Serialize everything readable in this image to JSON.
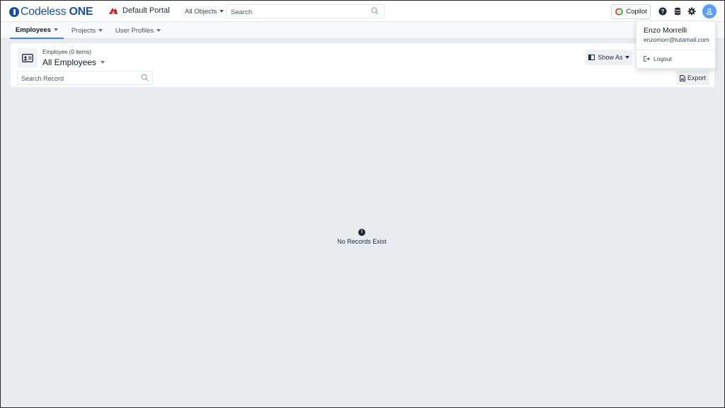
{
  "header": {
    "logo": {
      "prefix": "Codeless",
      "suffix": "ONE"
    },
    "portal_name": "Default Portal",
    "scope_select": "All Objects",
    "search_placeholder": "Search",
    "copilot_label": "Copilot",
    "icons": [
      "help-icon",
      "database-icon",
      "gear-icon",
      "user-icon"
    ]
  },
  "tabs": [
    {
      "label": "Employees",
      "active": true
    },
    {
      "label": "Projects",
      "active": false
    },
    {
      "label": "User Profiles",
      "active": false
    }
  ],
  "list": {
    "entity_subtitle": "Employee (0 items)",
    "view_title": "All Employees",
    "search_placeholder": "Search Record",
    "show_as_label": "Show As",
    "export_label": "Export"
  },
  "empty_state": {
    "message": "No Records Exist"
  },
  "user_menu": {
    "name": "Enzo Morrelli",
    "email": "enzomorr@tutamail.com",
    "logout_label": "Logout"
  },
  "colors": {
    "brand": "#1b4f9c",
    "accent": "#3b82f6",
    "avatar": "#5aa0ee",
    "portal_icon": "#c62828"
  }
}
